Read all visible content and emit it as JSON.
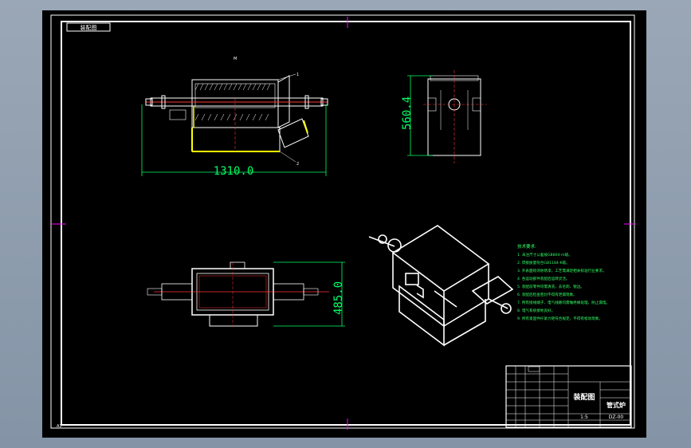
{
  "drawing": {
    "corner_label": "装配图",
    "sheet_size": "A1"
  },
  "front_view": {
    "dimension": "1310.0",
    "label_top": "M",
    "leader_1": "1",
    "leader_2": "2"
  },
  "side_view": {
    "dimension": "560.4"
  },
  "top_view": {
    "dimension": "485.0"
  },
  "technical_notes": {
    "title": "技术要求:",
    "lines": [
      "1. 未注尺寸公差按GB804-m级。",
      "2. 焊接质量符合GB1184-K级。",
      "3. 外表面喷涂防锈漆，工艺需满足相关标准行业要求。",
      "4. 各运动部件装配后运转灵活。",
      "5. 装配前零件均需清洗，去毛刺、锐边。",
      "6. 装配后检查密封不得有泄漏现象。",
      "7. 所有接线端子、电气线路均需做绝缘处理，防止漏电。",
      "8. 电气系统接地良好。",
      "9. 所有紧固件拧紧力矩符合规定，不得有松动现象。"
    ]
  },
  "title_block": {
    "drawing_type": "装配图",
    "product_name": "管式炉",
    "drawing_no": "DZ-00",
    "scale": "1:5"
  },
  "colors": {
    "background": "#000000",
    "outline": "#ffffff",
    "dimension": "#00ff66",
    "centerline": "#ff3333",
    "highlight": "#ffff00",
    "marker": "#ff00ff"
  }
}
